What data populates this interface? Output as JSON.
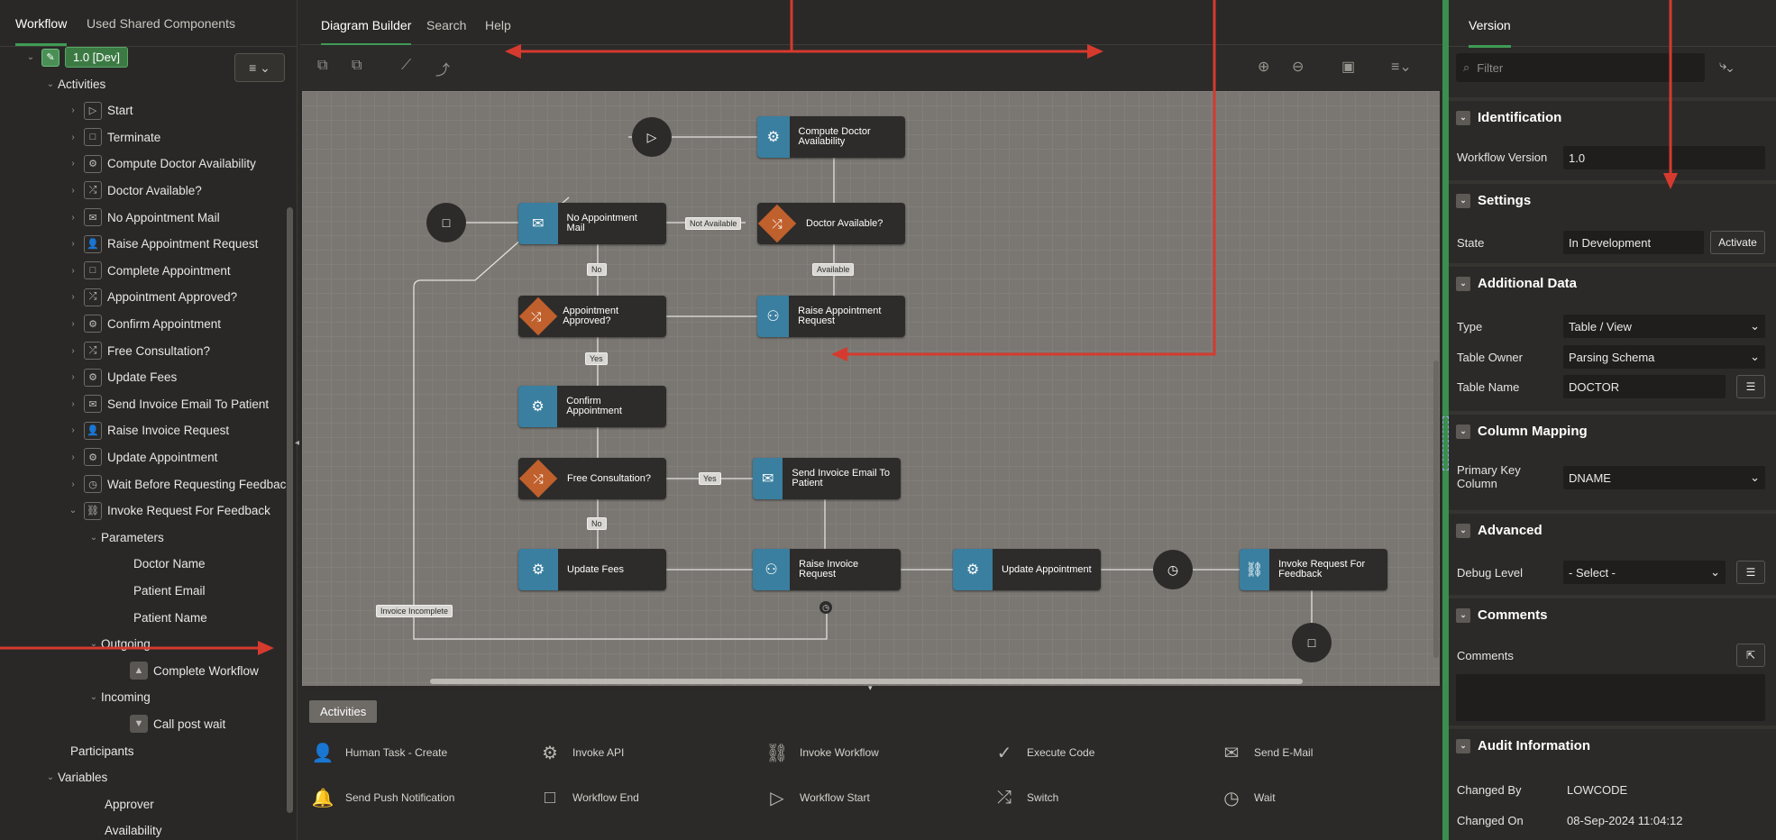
{
  "left": {
    "tabs": [
      "Workflow",
      "Used Shared Components"
    ],
    "version": "1.0 [Dev]",
    "menu_icon": "hamburger-menu-icon",
    "tree": [
      {
        "label": "Activities",
        "indent": 1,
        "twisty": "open",
        "icon": ""
      },
      {
        "label": "Start",
        "indent": 2,
        "twisty": "closed",
        "icon": "▷"
      },
      {
        "label": "Terminate",
        "indent": 2,
        "twisty": "closed",
        "icon": "□"
      },
      {
        "label": "Compute Doctor Availability",
        "indent": 2,
        "twisty": "closed",
        "icon": "⚙"
      },
      {
        "label": "Doctor Available?",
        "indent": 2,
        "twisty": "closed",
        "icon": "⤮"
      },
      {
        "label": "No Appointment Mail",
        "indent": 2,
        "twisty": "closed",
        "icon": "✉"
      },
      {
        "label": "Raise Appointment Request",
        "indent": 2,
        "twisty": "closed",
        "icon": "👤"
      },
      {
        "label": "Complete Appointment",
        "indent": 2,
        "twisty": "closed",
        "icon": "□"
      },
      {
        "label": "Appointment Approved?",
        "indent": 2,
        "twisty": "closed",
        "icon": "⤮"
      },
      {
        "label": "Confirm Appointment",
        "indent": 2,
        "twisty": "closed",
        "icon": "⚙"
      },
      {
        "label": "Free Consultation?",
        "indent": 2,
        "twisty": "closed",
        "icon": "⤮"
      },
      {
        "label": "Update Fees",
        "indent": 2,
        "twisty": "closed",
        "icon": "⚙"
      },
      {
        "label": "Send Invoice Email To Patient",
        "indent": 2,
        "twisty": "closed",
        "icon": "✉"
      },
      {
        "label": "Raise Invoice Request",
        "indent": 2,
        "twisty": "closed",
        "icon": "👤"
      },
      {
        "label": "Update Appointment",
        "indent": 2,
        "twisty": "closed",
        "icon": "⚙"
      },
      {
        "label": "Wait Before Requesting Feedback",
        "indent": 2,
        "twisty": "closed",
        "icon": "◷"
      },
      {
        "label": "Invoke Request For Feedback",
        "indent": 2,
        "twisty": "open",
        "icon": "⛓"
      },
      {
        "label": "Parameters",
        "indent": 3,
        "twisty": "open",
        "icon": ""
      },
      {
        "label": "Doctor Name",
        "indent": 4,
        "twisty": "",
        "icon": ""
      },
      {
        "label": "Patient Email",
        "indent": 4,
        "twisty": "",
        "icon": ""
      },
      {
        "label": "Patient Name",
        "indent": 4,
        "twisty": "",
        "icon": ""
      },
      {
        "label": "Outgoing",
        "indent": 3,
        "twisty": "open",
        "icon": ""
      },
      {
        "label": "Complete Workflow",
        "indent": 4,
        "twisty": "",
        "icon": "▲"
      },
      {
        "label": "Incoming",
        "indent": 3,
        "twisty": "open",
        "icon": ""
      },
      {
        "label": "Call post wait",
        "indent": 4,
        "twisty": "",
        "icon": "▼"
      },
      {
        "label": "Participants",
        "indent": 1,
        "twisty": "",
        "icon": ""
      },
      {
        "label": "Variables",
        "indent": 1,
        "twisty": "open",
        "icon": ""
      },
      {
        "label": "Approver",
        "indent": 3,
        "twisty": "",
        "icon": ""
      },
      {
        "label": "Availability",
        "indent": 3,
        "twisty": "",
        "icon": ""
      }
    ]
  },
  "center": {
    "tabs": [
      "Diagram Builder",
      "Search",
      "Help"
    ],
    "nodes": {
      "compute": "Compute Doctor Availability",
      "doctor_available": "Doctor Available?",
      "no_mail": "No Appointment Mail",
      "raise_appt": "Raise Appointment Request",
      "appt_approved": "Appointment Approved?",
      "confirm": "Confirm Appointment",
      "free": "Free Consultation?",
      "send_invoice": "Send Invoice Email To Patient",
      "update_fees": "Update Fees",
      "raise_invoice": "Raise Invoice Request",
      "update_appt": "Update Appointment",
      "invoke": "Invoke Request For Feedback"
    },
    "edges": {
      "not_available": "Not Available",
      "available": "Available",
      "no1": "No",
      "yes1": "Yes",
      "yes2": "Yes",
      "no2": "No",
      "invoice_incomplete": "Invoice Incomplete"
    },
    "palette_tab": "Activities",
    "palette": [
      {
        "label": "Human Task - Create",
        "icon": "person-icon",
        "glyph": "👤"
      },
      {
        "label": "Invoke API",
        "icon": "gear-icon",
        "glyph": "⚙"
      },
      {
        "label": "Invoke Workflow",
        "icon": "workflow-icon",
        "glyph": "⛓"
      },
      {
        "label": "Execute Code",
        "icon": "check-circle-icon",
        "glyph": "✓"
      },
      {
        "label": "Send E-Mail",
        "icon": "mail-icon",
        "glyph": "✉"
      },
      {
        "label": "Send Push Notification",
        "icon": "bell-icon",
        "glyph": "🔔"
      },
      {
        "label": "Workflow End",
        "icon": "square-icon",
        "glyph": "□"
      },
      {
        "label": "Workflow Start",
        "icon": "play-icon",
        "glyph": "▷"
      },
      {
        "label": "Switch",
        "icon": "switch-icon",
        "glyph": "⤮"
      },
      {
        "label": "Wait",
        "icon": "clock-icon",
        "glyph": "◷"
      }
    ]
  },
  "right": {
    "tab": "Version",
    "filter_placeholder": "Filter",
    "sections": {
      "identification": "Identification",
      "settings": "Settings",
      "additional": "Additional Data",
      "column_mapping": "Column Mapping",
      "advanced": "Advanced",
      "comments": "Comments",
      "audit": "Audit Information"
    },
    "fields": {
      "workflow_version_label": "Workflow Version",
      "workflow_version": "1.0",
      "state_label": "State",
      "state": "In Development",
      "activate": "Activate",
      "type_label": "Type",
      "type": "Table / View",
      "table_owner_label": "Table Owner",
      "table_owner": "Parsing Schema",
      "table_name_label": "Table Name",
      "table_name": "DOCTOR",
      "pk_label_1": "Primary Key",
      "pk_label_2": "Column",
      "pk": "DNAME",
      "debug_label": "Debug Level",
      "debug": "- Select -",
      "comments_label": "Comments",
      "changed_by_label": "Changed By",
      "changed_by": "LOWCODE",
      "changed_on_label": "Changed On",
      "changed_on": "08-Sep-2024 11:04:12"
    }
  },
  "colors": {
    "accent": "#3f9a55",
    "arrow": "#d63a2e",
    "activity": "#3a7fa0",
    "switch": "#c0602c"
  }
}
